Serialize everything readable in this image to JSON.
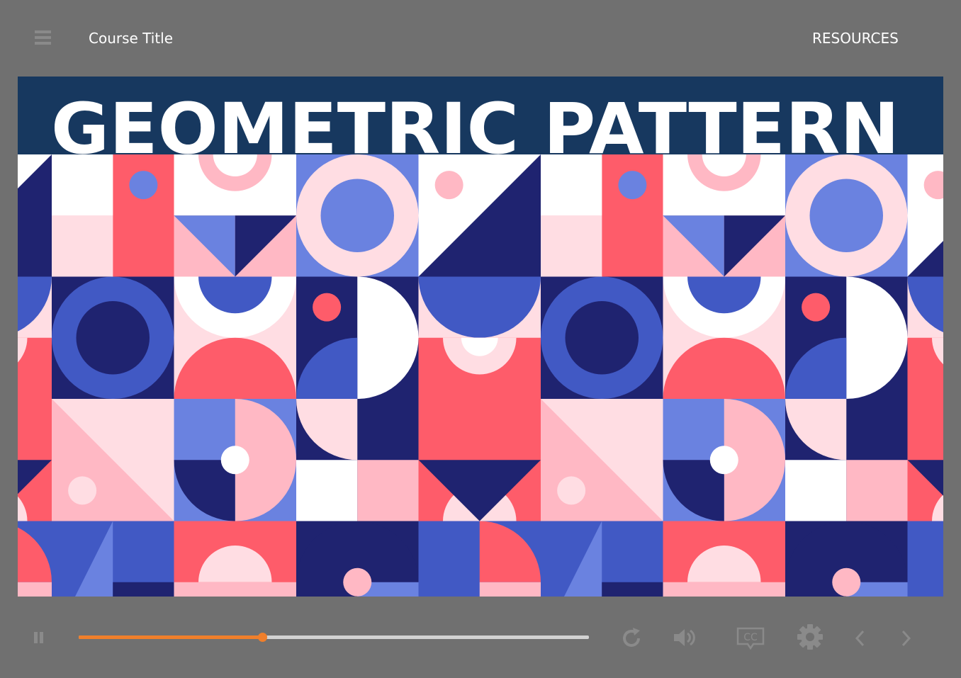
{
  "header": {
    "course_title": "Course Title",
    "resources_label": "RESOURCES"
  },
  "slide": {
    "title": "GEOMETRIC PATTERN"
  },
  "player": {
    "progress": 0.36,
    "accent_color": "#f07f2b",
    "icons": [
      "menu-icon",
      "pause-icon",
      "replay-icon",
      "volume-icon",
      "closed-captions-icon",
      "gear-icon",
      "chevron-left-icon",
      "chevron-right-icon"
    ],
    "cc_label": "CC"
  },
  "palette": {
    "navy": "#1f2370",
    "blue": "#4159c4",
    "light_blue": "#6a82e0",
    "red": "#fe5c6a",
    "pink": "#ffb8c4",
    "light_pink": "#ffdde3",
    "white": "#ffffff",
    "banner": "#17385f"
  }
}
